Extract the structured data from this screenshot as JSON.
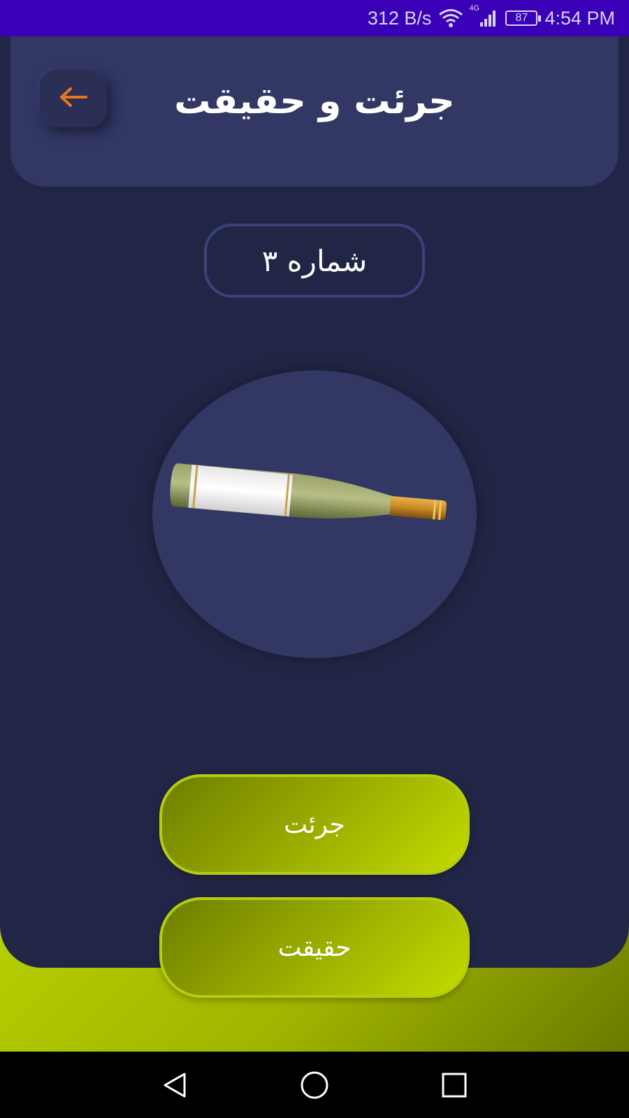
{
  "status_bar": {
    "network_speed": "312 B/s",
    "network_type": "4G",
    "battery": "87",
    "time": "4:54 PM",
    "icons": [
      "wifi-icon",
      "signal-icon",
      "battery-icon"
    ]
  },
  "header": {
    "title": "جرئت و حقیقت",
    "back_icon": "arrow-left-icon"
  },
  "counter": {
    "label": "شماره ۳"
  },
  "spinner": {
    "image": "bottle-image"
  },
  "buttons": {
    "dare_label": "جرئت",
    "truth_label": "حقیقت"
  },
  "navigation": {
    "icons": [
      "back-triangle-icon",
      "home-circle-icon",
      "recents-square-icon"
    ]
  },
  "colors": {
    "status_bar": "#3a00b8",
    "panel": "#222646",
    "card": "#323763",
    "accent": "#b9d300",
    "back_arrow": "#e8761c"
  }
}
